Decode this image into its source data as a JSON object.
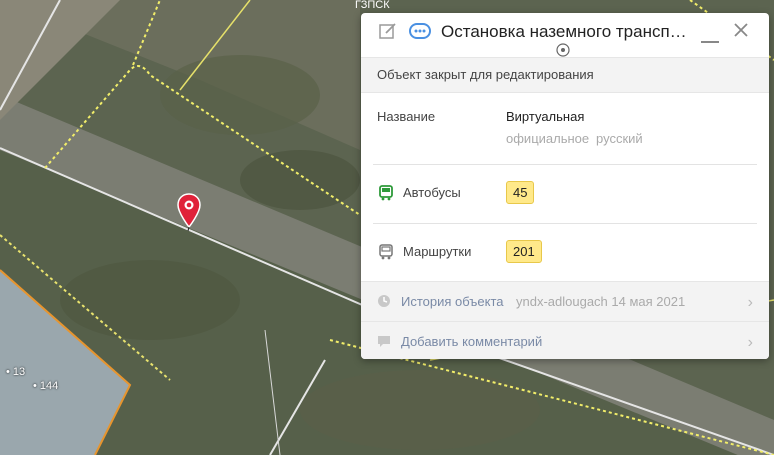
{
  "panel": {
    "title": "Остановка наземного транспо...",
    "notice": "Объект закрыт для редактирования",
    "name_label": "Название",
    "name_value": "Виртуальная",
    "name_sub_1": "официальное",
    "name_sub_2": "русский",
    "bus_label": "Автобусы",
    "bus_value": "45",
    "minibus_label": "Маршрутки",
    "minibus_value": "201",
    "history_label": "История объекта",
    "history_meta": "yndx-adlougach 14 мая 2021",
    "comment_label": "Добавить комментарий"
  },
  "map": {
    "house_labels": [
      "13",
      "144"
    ]
  },
  "colors": {
    "accent": "#4a90e2",
    "bus_green": "#2e9a3a",
    "badge_yellow": "#ffe98a",
    "pin_red": "#e0223a"
  }
}
